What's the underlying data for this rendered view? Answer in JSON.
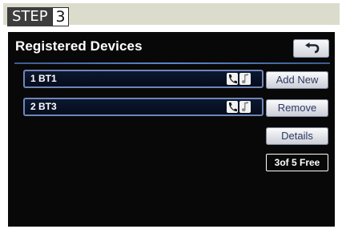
{
  "step": {
    "label": "STEP",
    "number": "3"
  },
  "screen": {
    "title": "Registered Devices",
    "back_icon": "back-arrow-icon",
    "devices": [
      {
        "name": "1  BT1",
        "icons": [
          "phone-icon",
          "music-note-icon"
        ]
      },
      {
        "name": "2  BT3",
        "icons": [
          "phone-icon",
          "music-note-icon"
        ]
      }
    ],
    "buttons": {
      "add_new": "Add New",
      "remove": "Remove",
      "details": "Details"
    },
    "capacity": "3of 5 Free"
  },
  "colors": {
    "screen_bg": "#080808",
    "button_text": "#2c3a63",
    "row_border": "#6f86b8"
  }
}
